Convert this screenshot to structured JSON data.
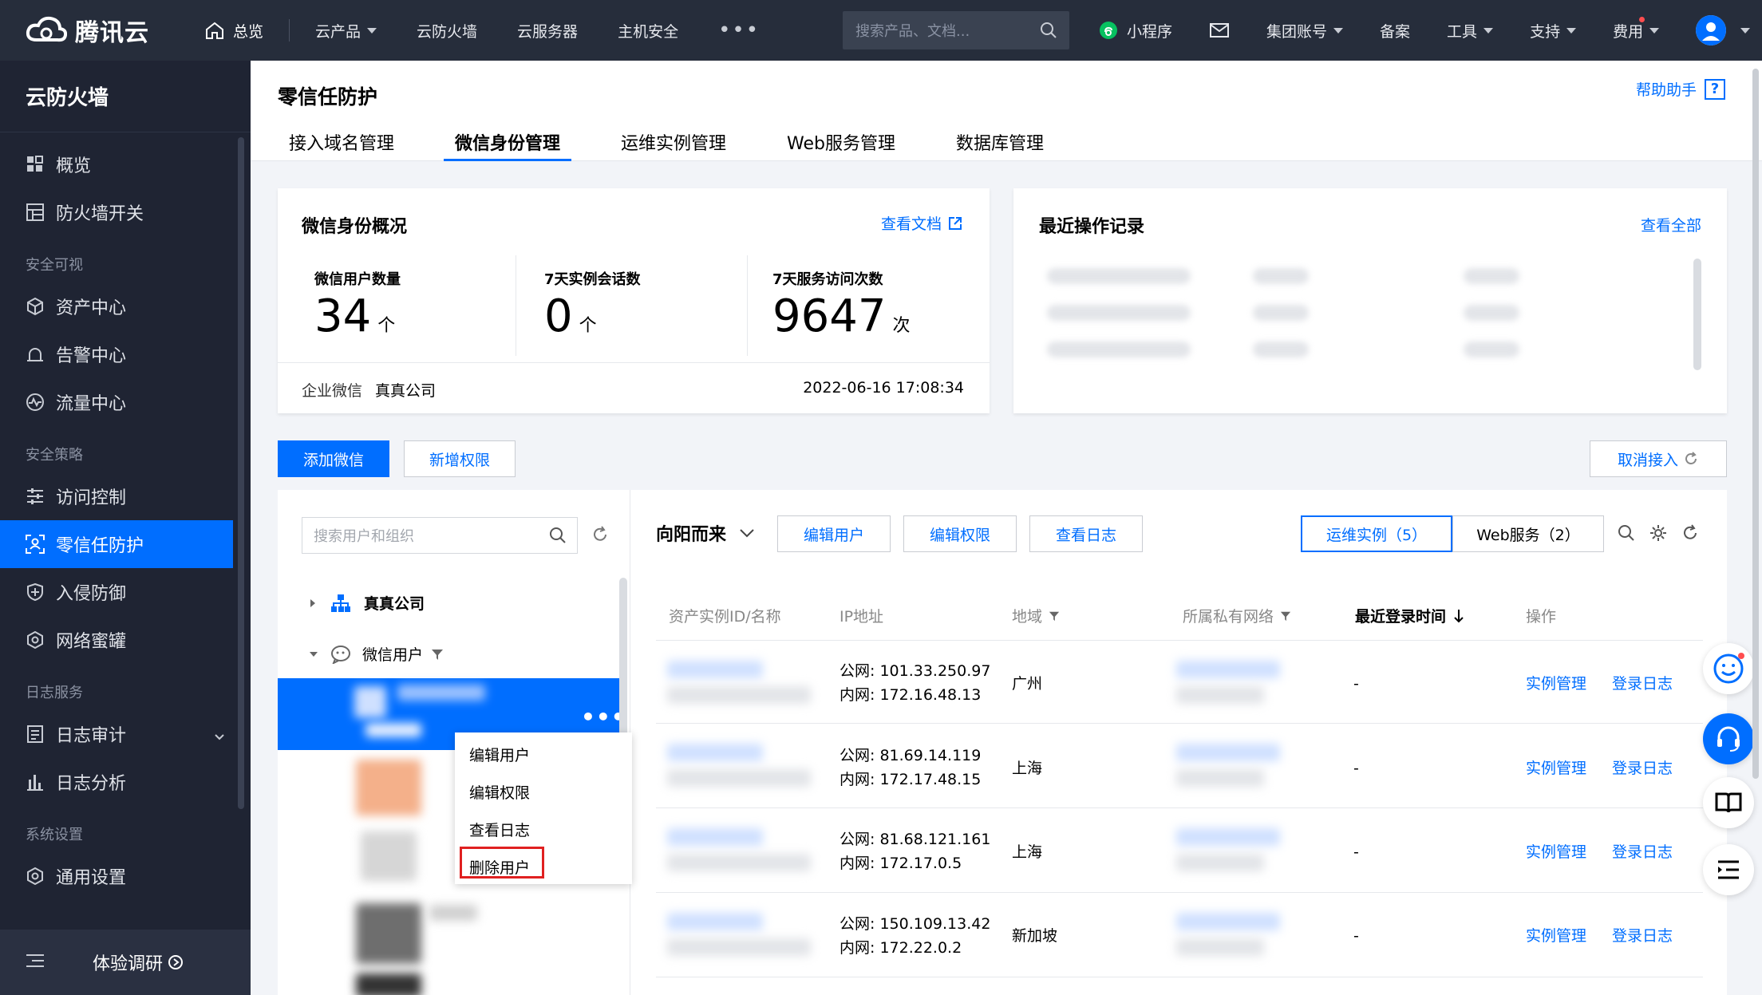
{
  "topbar": {
    "brand": "腾讯云",
    "home": "总览",
    "nav": [
      "云产品",
      "云防火墙",
      "云服务器",
      "主机安全"
    ],
    "more": "•••",
    "search_placeholder": "搜索产品、文档...",
    "miniprogram": "小程序",
    "group_account": "集团账号",
    "filing": "备案",
    "tools": "工具",
    "support": "支持",
    "cost": "费用"
  },
  "sidebar": {
    "title": "云防火墙",
    "items_top": [
      {
        "label": "概览",
        "icon": "grid-icon"
      },
      {
        "label": "防火墙开关",
        "icon": "table-icon"
      }
    ],
    "group_visual": "安全可视",
    "items_visual": [
      {
        "label": "资产中心",
        "icon": "cube-icon"
      },
      {
        "label": "告警中心",
        "icon": "alarm-icon"
      },
      {
        "label": "流量中心",
        "icon": "pulse-icon"
      }
    ],
    "group_policy": "安全策略",
    "items_policy": [
      {
        "label": "访问控制",
        "icon": "sliders-icon"
      },
      {
        "label": "零信任防护",
        "icon": "scan-user-icon"
      },
      {
        "label": "入侵防御",
        "icon": "shield-icon"
      },
      {
        "label": "网络蜜罐",
        "icon": "honeypot-icon"
      }
    ],
    "group_log": "日志服务",
    "items_log": [
      {
        "label": "日志审计",
        "icon": "log-icon"
      },
      {
        "label": "日志分析",
        "icon": "bar-chart-icon"
      }
    ],
    "group_system": "系统设置",
    "items_system": [
      {
        "label": "通用设置",
        "icon": "settings-icon"
      }
    ],
    "survey": "体验调研"
  },
  "header": {
    "title": "零信任防护",
    "help": "帮助助手",
    "tabs": [
      "接入域名管理",
      "微信身份管理",
      "运维实例管理",
      "Web服务管理",
      "数据库管理"
    ]
  },
  "overview": {
    "title": "微信身份概况",
    "doc_link": "查看文档",
    "stats": [
      {
        "label": "微信用户数量",
        "value": "34",
        "unit": "个"
      },
      {
        "label": "7天实例会话数",
        "value": "0",
        "unit": "个"
      },
      {
        "label": "7天服务访问次数",
        "value": "9647",
        "unit": "次"
      }
    ],
    "company_label": "企业微信",
    "company_name": "真真公司",
    "date": "2022-06-16 17:08:34"
  },
  "records": {
    "title": "最近操作记录",
    "view_all": "查看全部"
  },
  "actions": {
    "add_wechat": "添加微信",
    "add_permission": "新增权限",
    "cancel_access": "取消接入"
  },
  "tree": {
    "search_placeholder": "搜索用户和组织",
    "org": "真真公司",
    "group": "微信用户"
  },
  "context_menu": [
    "编辑用户",
    "编辑权限",
    "查看日志",
    "删除用户"
  ],
  "user_panel": {
    "user_name": "向阳而来",
    "buttons": [
      "编辑用户",
      "编辑权限",
      "查看日志"
    ],
    "seg_instances": "运维实例（5）",
    "seg_web": "Web服务（2）"
  },
  "table": {
    "headers": [
      "资产实例ID/名称",
      "IP地址",
      "地域",
      "所属私有网络",
      "最近登录时间",
      "操作"
    ],
    "rows": [
      {
        "public_ip": "公网: 101.33.250.97",
        "private_ip": "内网: 172.16.48.13",
        "region": "广州",
        "last_login": "-",
        "op1": "实例管理",
        "op2": "登录日志"
      },
      {
        "public_ip": "公网: 81.69.14.119",
        "private_ip": "内网: 172.17.48.15",
        "region": "上海",
        "last_login": "-",
        "op1": "实例管理",
        "op2": "登录日志"
      },
      {
        "public_ip": "公网: 81.68.121.161",
        "private_ip": "内网: 172.17.0.5",
        "region": "上海",
        "last_login": "-",
        "op1": "实例管理",
        "op2": "登录日志"
      },
      {
        "public_ip": "公网: 150.109.13.42",
        "private_ip": "内网: 172.22.0.2",
        "region": "新加坡",
        "last_login": "-",
        "op1": "实例管理",
        "op2": "登录日志"
      }
    ]
  },
  "colors": {
    "accent": "#006eff",
    "topbar": "#262d3b",
    "sidebar": "#1f2433",
    "danger": "#e02020"
  }
}
